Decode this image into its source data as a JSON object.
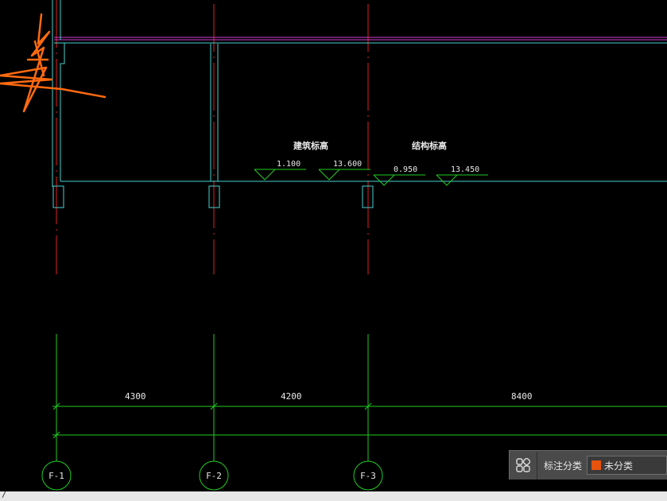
{
  "drawing": {
    "elevation_labels": {
      "building": "建筑标高",
      "structure": "结构标高"
    },
    "elevations": [
      "1.100",
      "13.600",
      "0.950",
      "13.450"
    ],
    "dimensions": [
      "4300",
      "4200",
      "8400"
    ],
    "axes": [
      "F-1",
      "F-2",
      "F-3"
    ]
  },
  "panel": {
    "label": "标注分类",
    "selected_value": "未分类",
    "swatch_color": "#e8530e",
    "icon": "grid-settings-icon"
  },
  "command_line": {
    "prompt": "/"
  },
  "colors": {
    "axis_line": "#e02020",
    "dimension_line": "#22cc22",
    "wall_line": "#4ad0d0",
    "beam_line": "#d040d0",
    "sketch": "#ff6a10"
  }
}
